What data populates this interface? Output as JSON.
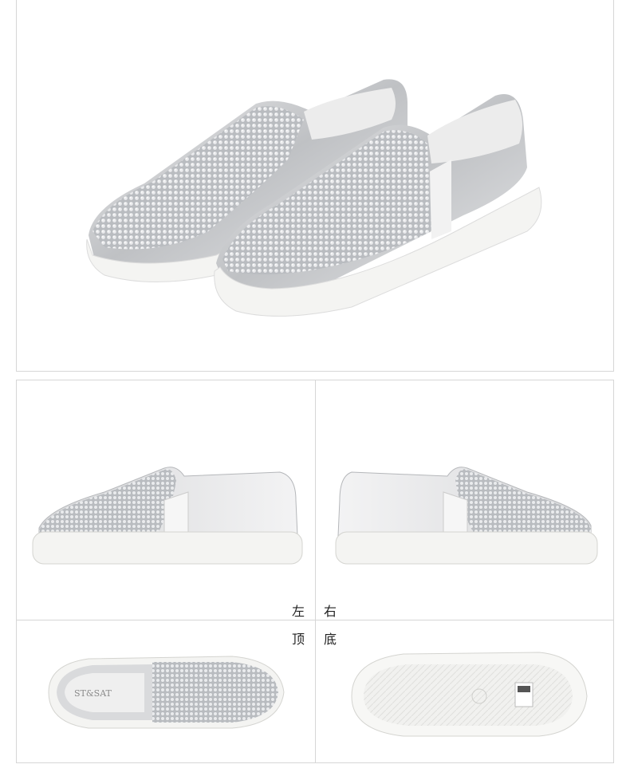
{
  "captions": {
    "left": "左",
    "right": "右",
    "top": "顶",
    "bottom": "底"
  },
  "brand": {
    "insole_logo": "ST&SAT"
  },
  "colors": {
    "silver": "#c9cbce",
    "silver_dark": "#9a9ca0",
    "sole": "#f4f4f2",
    "border": "#d6d6d6"
  }
}
